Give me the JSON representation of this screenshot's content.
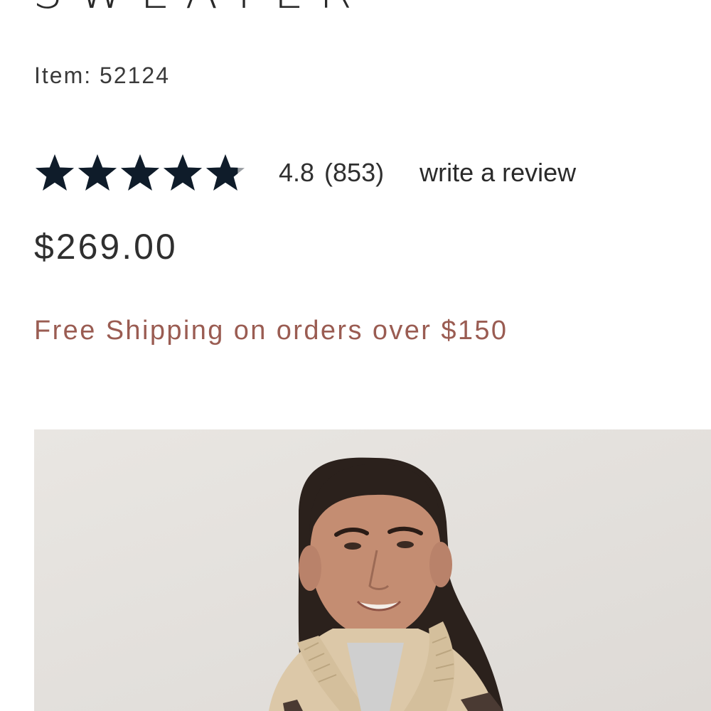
{
  "product": {
    "title": "SWEATER",
    "item_label": "Item:",
    "item_number": "52124",
    "rating": {
      "stars": 4.8,
      "value_text": "4.8",
      "count_text": "(853)",
      "write_review_label": "write a review",
      "star_color": "#0f1c2a",
      "star_empty_color": "#9a9ea3"
    },
    "price": "$269.00",
    "shipping_text": "Free Shipping on orders over $150",
    "shipping_color": "#9a5c52",
    "image": {
      "icon": "product-photo"
    }
  }
}
